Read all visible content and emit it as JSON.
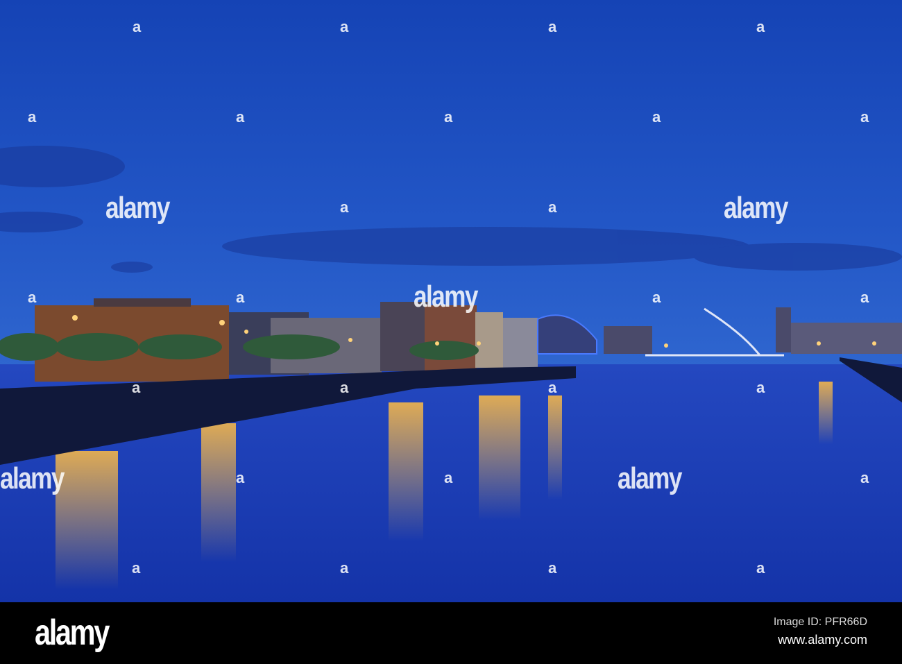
{
  "watermark": {
    "text": "alamy",
    "mark": "a"
  },
  "footer": {
    "logo": "alamy",
    "image_id": "Image ID: PFR66D",
    "url": "www.alamy.com"
  },
  "colors": {
    "sky_top": "#1746b8",
    "sky_horizon": "#2a62d0",
    "water": "#1b3fb8",
    "lights": "#f5b945"
  }
}
